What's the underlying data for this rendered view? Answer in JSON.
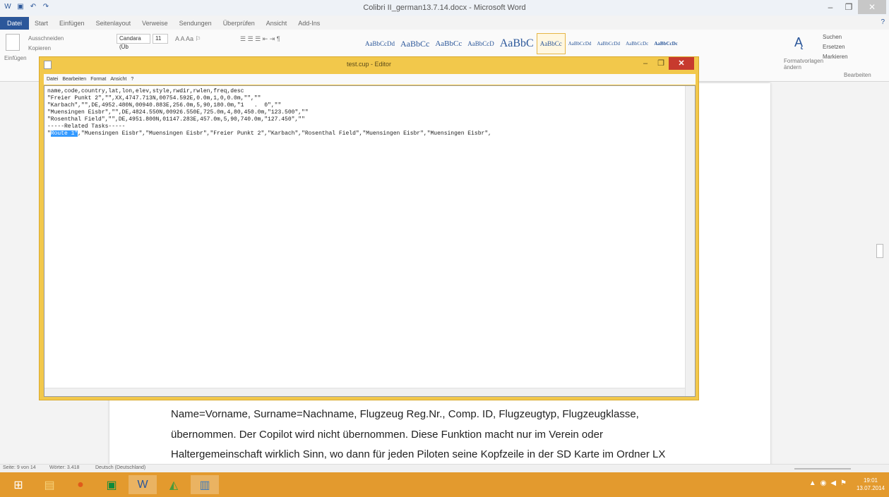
{
  "word": {
    "title": "Colibri II_german13.7.14.docx - Microsoft Word",
    "tabs": [
      "Datei",
      "Start",
      "Einfügen",
      "Seitenlayout",
      "Verweise",
      "Sendungen",
      "Überprüfen",
      "Ansicht",
      "Add-Ins"
    ],
    "ribbon": {
      "paste_label": "Einfügen",
      "cut_label": "Ausschneiden",
      "copy_label": "Kopieren",
      "font_name": "Candara (Üb",
      "font_size": "11",
      "styles": [
        "AaBbCcDd",
        "AaBbCc",
        "AaBbCc",
        "AaBbCcD",
        "AaBbC",
        "AaBbCc",
        "AaBbCcDd",
        "AaBbCcDd",
        "AaBbCcDc",
        "AaBbCcDc"
      ],
      "format_label": "Formatvorlagen ändern",
      "find_label": "Suchen",
      "replace_label": "Ersetzen",
      "select_label": "Markieren",
      "edit_group": "Bearbeiten"
    },
    "document_lines": [
      "Name=Vorname, Surname=Nachname, Flugzeug Reg.Nr., Comp. ID, Flugzeugtyp, Flugzeugklasse,",
      "übernommen. Der Copilot wird nicht übernommen. Diese Funktion macht nur im Verein oder",
      "Haltergemeinschaft wirklich Sinn, wo dann für jeden Piloten seine Kopfzeile in der SD Karte im Ordner LX"
    ],
    "status": {
      "page": "Seite: 9 von 14",
      "words": "Wörter: 3.418",
      "lang": "Deutsch (Deutschland)"
    }
  },
  "notepad": {
    "title": "test.cup - Editor",
    "menu": [
      "Datei",
      "Bearbeiten",
      "Format",
      "Ansicht",
      "?"
    ],
    "lines": [
      "name,code,country,lat,lon,elev,style,rwdir,rwlen,freq,desc",
      "\"Freier Punkt 2\",\"\",XX,4747.713N,00754.592E,0.0m,1,0,0.0m,\"\",\"\"",
      "\"Karbach\",\"\",DE,4952.480N,00940.883E,256.0m,5,90,180.0m,\"1   .  0\",\"\"",
      "\"Muensingen Eisbr\",\"\",DE,4824.550N,00926.550E,725.0m,4,80,450.0m,\"123.500\",\"\"",
      "\"Rosenthal Field\",\"\",DE,4951.800N,01147.283E,457.0m,5,90,740.0m,\"127.450\",\"\"",
      "-----Related Tasks-----"
    ],
    "task_prefix": "\"",
    "task_selected": "Route 1\"",
    "task_rest": ",\"Muensingen Eisbr\",\"Muensingen Eisbr\",\"Freier Punkt 2\",\"Karbach\",\"Rosenthal Field\",\"Muensingen Eisbr\",\"Muensingen Eisbr\","
  },
  "taskbar": {
    "time": "19:01",
    "date": "13.07.2014"
  },
  "colors": {
    "word_blue": "#2b579a",
    "notepad_frame": "#f2c84b",
    "taskbar": "#e39a2e",
    "selection": "#3399ff"
  }
}
